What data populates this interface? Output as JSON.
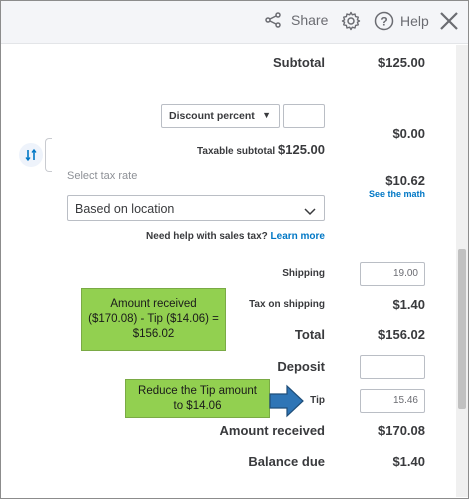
{
  "header": {
    "share_label": "Share",
    "help_label": "Help",
    "icons": [
      "share-icon",
      "gear-icon",
      "help-icon",
      "close-icon"
    ]
  },
  "summary": {
    "subtotal_label": "Subtotal",
    "subtotal_value": "$125.00",
    "discount_select": "Discount percent",
    "discount_value": "",
    "discount_amount": "$0.00",
    "taxable_subtotal_label": "Taxable subtotal",
    "taxable_subtotal_value": "$125.00",
    "select_tax_rate_label": "Select tax rate",
    "tax_rate_select": "Based on location",
    "tax_amount": "$10.62",
    "see_math_link": "See the math",
    "help_sales_tax_text": "Need help with sales tax?",
    "learn_more_link": "Learn more",
    "shipping_label": "Shipping",
    "shipping_value": "19.00",
    "tax_on_shipping_label": "Tax on shipping",
    "tax_on_shipping_value": "$1.40",
    "total_label": "Total",
    "total_value": "$156.02",
    "deposit_label": "Deposit",
    "deposit_value": "",
    "tip_label": "Tip",
    "tip_value": "15.46",
    "amount_received_label": "Amount received",
    "amount_received_value": "$170.08",
    "balance_due_label": "Balance due",
    "balance_due_value": "$1.40"
  },
  "annotations": {
    "callout_amount_line1": "Amount received",
    "callout_amount_line2": "($170.08) - Tip ($14.06) =",
    "callout_amount_line3": "$156.02",
    "callout_tip_line1": "Reduce the Tip amount",
    "callout_tip_line2": "to $14.06",
    "callout_color": "#92d050",
    "arrow_color": "#2e75b6"
  }
}
